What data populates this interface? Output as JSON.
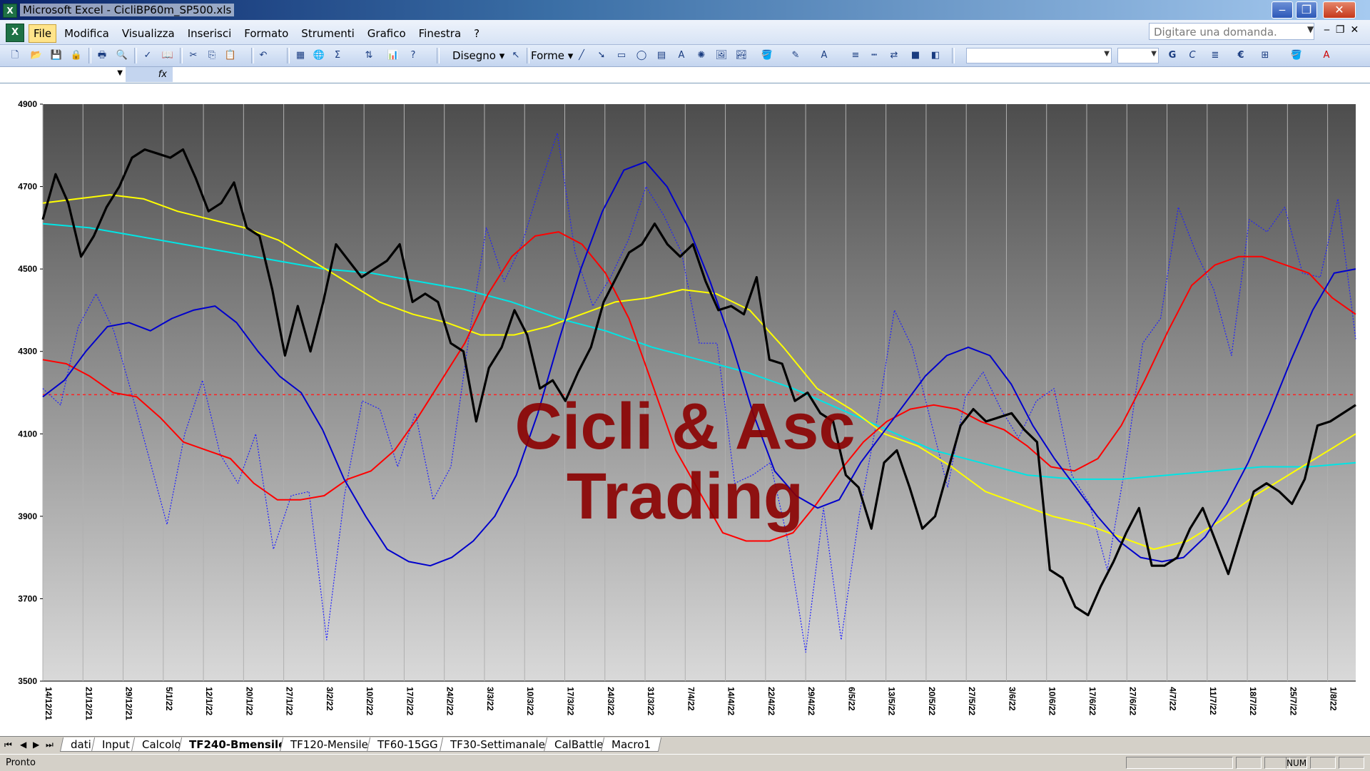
{
  "window": {
    "title": "Microsoft Excel - CicliBP60m_SP500.xls",
    "minimize": "‒",
    "maximize": "❐",
    "close": "✕"
  },
  "menubar": {
    "items": [
      "File",
      "Modifica",
      "Visualizza",
      "Inserisci",
      "Formato",
      "Strumenti",
      "Grafico",
      "Finestra",
      "?"
    ],
    "active_index": 0,
    "help_placeholder": "Digitare una domanda.",
    "doc_buttons": [
      "‒",
      "❐",
      "✕"
    ]
  },
  "toolbar": {
    "draw_label": "Disegno",
    "shapes_label": "Forme",
    "bold": "G",
    "italic": "C",
    "euro": "€",
    "sigma": "Σ"
  },
  "formula_bar": {
    "fx": "fx"
  },
  "chart": {
    "watermark_line1": "Cicli & Asc",
    "watermark_line2": "Trading"
  },
  "chart_data": {
    "type": "line",
    "title": "",
    "xlabel": "",
    "ylabel": "",
    "ylim": [
      3500,
      4900
    ],
    "yticks": [
      3500,
      3700,
      3900,
      4100,
      4300,
      4500,
      4700,
      4900
    ],
    "xticks": [
      "14/12/21",
      "21/12/21",
      "29/12/21",
      "5/1/22",
      "12/1/22",
      "20/1/22",
      "27/1/22",
      "3/2/22",
      "10/2/22",
      "17/2/22",
      "24/2/22",
      "3/3/22",
      "10/3/22",
      "17/3/22",
      "24/3/22",
      "31/3/22",
      "7/4/22",
      "14/4/22",
      "22/4/22",
      "29/4/22",
      "6/5/22",
      "13/5/22",
      "20/5/22",
      "27/5/22",
      "3/6/22",
      "10/6/22",
      "17/6/22",
      "27/6/22",
      "4/7/22",
      "11/7/22",
      "18/7/22",
      "25/7/22",
      "1/8/22"
    ],
    "reference_line": 4195,
    "series": [
      {
        "color": "#000000",
        "style": "solid",
        "values": [
          4620,
          4730,
          4660,
          4530,
          4580,
          4650,
          4700,
          4770,
          4790,
          4780,
          4770,
          4790,
          4720,
          4640,
          4660,
          4710,
          4600,
          4580,
          4450,
          4290,
          4410,
          4300,
          4420,
          4560,
          4520,
          4480,
          4500,
          4520,
          4560,
          4420,
          4440,
          4420,
          4320,
          4300,
          4130,
          4260,
          4310,
          4400,
          4340,
          4210,
          4230,
          4180,
          4250,
          4310,
          4420,
          4480,
          4540,
          4560,
          4610,
          4560,
          4530,
          4560,
          4470,
          4400,
          4410,
          4390,
          4480,
          4280,
          4270,
          4180,
          4200,
          4150,
          4130,
          4000,
          3970,
          3870,
          4030,
          4060,
          3970,
          3870,
          3900,
          4010,
          4120,
          4160,
          4130,
          4140,
          4150,
          4110,
          4080,
          3770,
          3750,
          3680,
          3660,
          3730,
          3790,
          3860,
          3920,
          3780,
          3780,
          3800,
          3870,
          3920,
          3840,
          3760,
          3860,
          3960,
          3980,
          3960,
          3930,
          3990,
          4120,
          4130,
          4150,
          4170
        ]
      },
      {
        "color": "#0000cc",
        "style": "solid",
        "values": [
          4190,
          4230,
          4300,
          4360,
          4370,
          4350,
          4380,
          4400,
          4410,
          4370,
          4300,
          4240,
          4200,
          4110,
          3990,
          3900,
          3820,
          3790,
          3780,
          3800,
          3840,
          3900,
          4000,
          4150,
          4330,
          4500,
          4640,
          4740,
          4760,
          4700,
          4600,
          4470,
          4320,
          4150,
          4010,
          3950,
          3920,
          3940,
          4030,
          4100,
          4170,
          4240,
          4290,
          4310,
          4290,
          4220,
          4120,
          4040,
          3970,
          3900,
          3840,
          3800,
          3790,
          3800,
          3850,
          3930,
          4030,
          4150,
          4280,
          4400,
          4490,
          4500
        ]
      },
      {
        "color": "#ff0000",
        "style": "solid",
        "values": [
          4280,
          4270,
          4240,
          4200,
          4190,
          4140,
          4080,
          4060,
          4040,
          3980,
          3940,
          3940,
          3950,
          3990,
          4010,
          4060,
          4140,
          4230,
          4320,
          4440,
          4530,
          4580,
          4590,
          4560,
          4490,
          4380,
          4220,
          4060,
          3960,
          3860,
          3840,
          3840,
          3860,
          3930,
          4010,
          4080,
          4130,
          4160,
          4170,
          4160,
          4130,
          4110,
          4070,
          4020,
          4010,
          4040,
          4120,
          4230,
          4350,
          4460,
          4510,
          4530,
          4530,
          4510,
          4490,
          4430,
          4390
        ]
      },
      {
        "color": "#ffff00",
        "style": "solid",
        "values": [
          4660,
          4670,
          4680,
          4670,
          4640,
          4620,
          4600,
          4570,
          4520,
          4470,
          4420,
          4390,
          4370,
          4340,
          4340,
          4360,
          4390,
          4420,
          4430,
          4450,
          4440,
          4400,
          4310,
          4210,
          4160,
          4100,
          4070,
          4020,
          3960,
          3930,
          3900,
          3880,
          3850,
          3820,
          3840,
          3890,
          3950,
          4000,
          4050,
          4100
        ]
      },
      {
        "color": "#00e5e5",
        "style": "solid",
        "values": [
          4610,
          4600,
          4580,
          4560,
          4540,
          4520,
          4500,
          4490,
          4470,
          4450,
          4420,
          4380,
          4350,
          4310,
          4280,
          4250,
          4210,
          4160,
          4110,
          4060,
          4030,
          4000,
          3990,
          3990,
          4000,
          4010,
          4020,
          4020,
          4030
        ]
      },
      {
        "color": "#2020ff",
        "style": "dotted",
        "values": [
          4210,
          4170,
          4360,
          4440,
          4350,
          4200,
          4040,
          3880,
          4100,
          4230,
          4050,
          3980,
          4100,
          3820,
          3950,
          3960,
          3600,
          3950,
          4180,
          4160,
          4020,
          4150,
          3940,
          4020,
          4330,
          4600,
          4470,
          4560,
          4700,
          4830,
          4540,
          4410,
          4480,
          4570,
          4700,
          4630,
          4540,
          4320,
          4320,
          3980,
          4000,
          4030,
          3840,
          3570,
          3920,
          3600,
          3900,
          4130,
          4400,
          4310,
          4140,
          3970,
          4190,
          4250,
          4160,
          4090,
          4180,
          4210,
          4000,
          3930,
          3770,
          4020,
          4320,
          4380,
          4650,
          4540,
          4450,
          4290,
          4620,
          4590,
          4650,
          4490,
          4480,
          4670,
          4330
        ]
      }
    ]
  },
  "sheets": {
    "tabs": [
      "dati",
      "Input",
      "Calcolo",
      "TF240-Bmensile",
      "TF120-Mensile",
      "TF60-15GG",
      "TF30-Settimanale",
      "CalBattle",
      "Macro1"
    ],
    "active_index": 3,
    "nav": [
      "⏮",
      "◀",
      "▶",
      "⏭"
    ]
  },
  "status": {
    "text": "Pronto",
    "num": "NUM"
  }
}
